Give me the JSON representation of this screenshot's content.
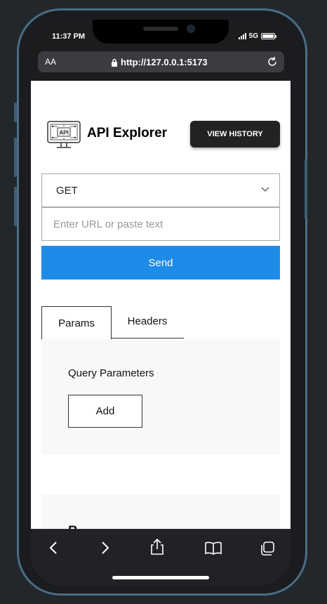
{
  "status": {
    "time": "11:37 PM",
    "network": "5G"
  },
  "browser": {
    "text_size_label": "AA",
    "url": "http://127.0.0.1:5173"
  },
  "app": {
    "title": "API Explorer",
    "logo_text": "API",
    "history_button": "VIEW HISTORY",
    "method": {
      "selected": "GET"
    },
    "url_input": {
      "value": "",
      "placeholder": "Enter URL or paste text"
    },
    "send_button": "Send",
    "tabs": [
      {
        "label": "Params",
        "active": true
      },
      {
        "label": "Headers",
        "active": false
      }
    ],
    "params_panel": {
      "title": "Query Parameters",
      "add_button": "Add"
    },
    "second_panel": {
      "title_partial": "B"
    }
  },
  "toolbar": {
    "icons": [
      "back-icon",
      "forward-icon",
      "share-icon",
      "bookmarks-icon",
      "tabs-icon"
    ]
  },
  "colors": {
    "accent": "#1f8be8",
    "dark_button": "#222222",
    "phone_frame": "#4a6d84"
  }
}
